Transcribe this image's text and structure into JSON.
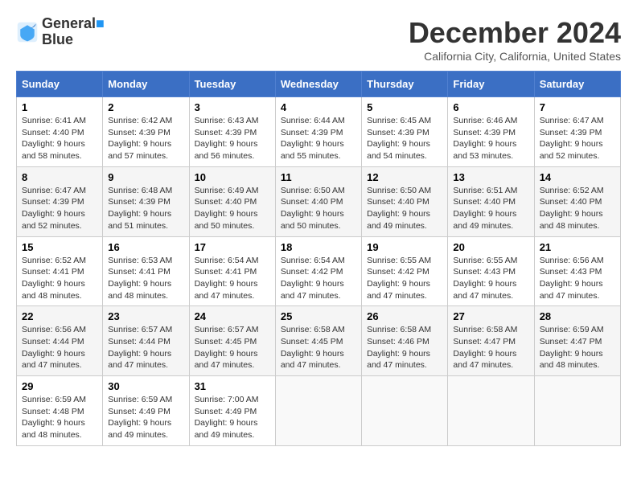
{
  "logo": {
    "line1": "General",
    "line2": "Blue"
  },
  "title": "December 2024",
  "subtitle": "California City, California, United States",
  "headers": [
    "Sunday",
    "Monday",
    "Tuesday",
    "Wednesday",
    "Thursday",
    "Friday",
    "Saturday"
  ],
  "weeks": [
    [
      {
        "day": "1",
        "sunrise": "6:41 AM",
        "sunset": "4:40 PM",
        "daylight": "9 hours and 58 minutes."
      },
      {
        "day": "2",
        "sunrise": "6:42 AM",
        "sunset": "4:39 PM",
        "daylight": "9 hours and 57 minutes."
      },
      {
        "day": "3",
        "sunrise": "6:43 AM",
        "sunset": "4:39 PM",
        "daylight": "9 hours and 56 minutes."
      },
      {
        "day": "4",
        "sunrise": "6:44 AM",
        "sunset": "4:39 PM",
        "daylight": "9 hours and 55 minutes."
      },
      {
        "day": "5",
        "sunrise": "6:45 AM",
        "sunset": "4:39 PM",
        "daylight": "9 hours and 54 minutes."
      },
      {
        "day": "6",
        "sunrise": "6:46 AM",
        "sunset": "4:39 PM",
        "daylight": "9 hours and 53 minutes."
      },
      {
        "day": "7",
        "sunrise": "6:47 AM",
        "sunset": "4:39 PM",
        "daylight": "9 hours and 52 minutes."
      }
    ],
    [
      {
        "day": "8",
        "sunrise": "6:47 AM",
        "sunset": "4:39 PM",
        "daylight": "9 hours and 52 minutes."
      },
      {
        "day": "9",
        "sunrise": "6:48 AM",
        "sunset": "4:39 PM",
        "daylight": "9 hours and 51 minutes."
      },
      {
        "day": "10",
        "sunrise": "6:49 AM",
        "sunset": "4:40 PM",
        "daylight": "9 hours and 50 minutes."
      },
      {
        "day": "11",
        "sunrise": "6:50 AM",
        "sunset": "4:40 PM",
        "daylight": "9 hours and 50 minutes."
      },
      {
        "day": "12",
        "sunrise": "6:50 AM",
        "sunset": "4:40 PM",
        "daylight": "9 hours and 49 minutes."
      },
      {
        "day": "13",
        "sunrise": "6:51 AM",
        "sunset": "4:40 PM",
        "daylight": "9 hours and 49 minutes."
      },
      {
        "day": "14",
        "sunrise": "6:52 AM",
        "sunset": "4:40 PM",
        "daylight": "9 hours and 48 minutes."
      }
    ],
    [
      {
        "day": "15",
        "sunrise": "6:52 AM",
        "sunset": "4:41 PM",
        "daylight": "9 hours and 48 minutes."
      },
      {
        "day": "16",
        "sunrise": "6:53 AM",
        "sunset": "4:41 PM",
        "daylight": "9 hours and 48 minutes."
      },
      {
        "day": "17",
        "sunrise": "6:54 AM",
        "sunset": "4:41 PM",
        "daylight": "9 hours and 47 minutes."
      },
      {
        "day": "18",
        "sunrise": "6:54 AM",
        "sunset": "4:42 PM",
        "daylight": "9 hours and 47 minutes."
      },
      {
        "day": "19",
        "sunrise": "6:55 AM",
        "sunset": "4:42 PM",
        "daylight": "9 hours and 47 minutes."
      },
      {
        "day": "20",
        "sunrise": "6:55 AM",
        "sunset": "4:43 PM",
        "daylight": "9 hours and 47 minutes."
      },
      {
        "day": "21",
        "sunrise": "6:56 AM",
        "sunset": "4:43 PM",
        "daylight": "9 hours and 47 minutes."
      }
    ],
    [
      {
        "day": "22",
        "sunrise": "6:56 AM",
        "sunset": "4:44 PM",
        "daylight": "9 hours and 47 minutes."
      },
      {
        "day": "23",
        "sunrise": "6:57 AM",
        "sunset": "4:44 PM",
        "daylight": "9 hours and 47 minutes."
      },
      {
        "day": "24",
        "sunrise": "6:57 AM",
        "sunset": "4:45 PM",
        "daylight": "9 hours and 47 minutes."
      },
      {
        "day": "25",
        "sunrise": "6:58 AM",
        "sunset": "4:45 PM",
        "daylight": "9 hours and 47 minutes."
      },
      {
        "day": "26",
        "sunrise": "6:58 AM",
        "sunset": "4:46 PM",
        "daylight": "9 hours and 47 minutes."
      },
      {
        "day": "27",
        "sunrise": "6:58 AM",
        "sunset": "4:47 PM",
        "daylight": "9 hours and 47 minutes."
      },
      {
        "day": "28",
        "sunrise": "6:59 AM",
        "sunset": "4:47 PM",
        "daylight": "9 hours and 48 minutes."
      }
    ],
    [
      {
        "day": "29",
        "sunrise": "6:59 AM",
        "sunset": "4:48 PM",
        "daylight": "9 hours and 48 minutes."
      },
      {
        "day": "30",
        "sunrise": "6:59 AM",
        "sunset": "4:49 PM",
        "daylight": "9 hours and 49 minutes."
      },
      {
        "day": "31",
        "sunrise": "7:00 AM",
        "sunset": "4:49 PM",
        "daylight": "9 hours and 49 minutes."
      },
      null,
      null,
      null,
      null
    ]
  ]
}
